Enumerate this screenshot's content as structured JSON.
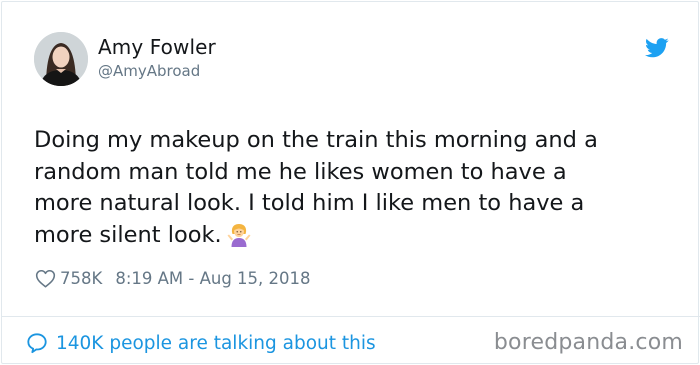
{
  "author": {
    "name": "Amy Fowler",
    "handle": "@AmyAbroad",
    "avatar_icon": "profile-photo"
  },
  "tweet": {
    "lines": [
      "Doing my makeup on the train this morning and a",
      "random man told me he likes women to have a",
      "more natural look. I told him I like men to have a",
      "more silent look."
    ],
    "emoji_icon": "woman-shrugging-emoji",
    "likes": "758K",
    "timestamp": "8:19 AM - Aug 15, 2018"
  },
  "footer": {
    "talking": "140K people are talking about this",
    "watermark": "boredpanda.com"
  },
  "colors": {
    "accent": "#1da1f2",
    "link": "#1b95e0",
    "text": "#14171a",
    "muted": "#657786",
    "border": "#e1e8ed"
  },
  "icons": {
    "brand": "twitter-bird-icon",
    "like": "heart-icon",
    "reply": "speech-bubble-icon"
  }
}
